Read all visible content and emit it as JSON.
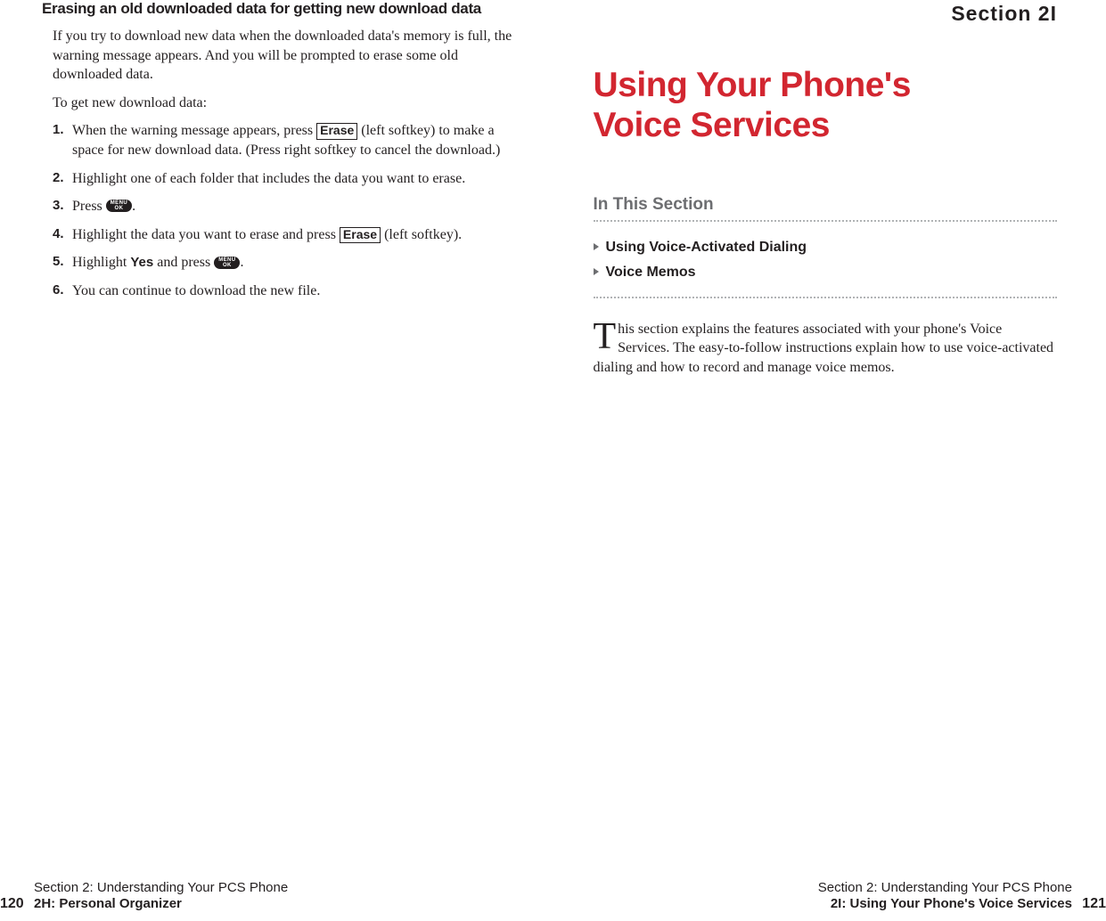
{
  "left": {
    "heading": "Erasing an old downloaded data for getting new download data",
    "intro": "If you try to download new data when the downloaded data's memory is full, the warning message appears. And you will be prompted to erase some old downloaded data.",
    "lead": "To get new download data:",
    "steps": {
      "s1a": "When the warning message appears, press ",
      "s1_key": "Erase",
      "s1b": " (left softkey) to make a space for new download data. (Press right softkey to cancel the download.)",
      "s2": "Highlight one of each folder that includes the data you want to erase.",
      "s3a": "Press ",
      "s3b": ".",
      "s4a": "Highlight the data you want to erase and press ",
      "s4_key": "Erase",
      "s4b": " (left softkey).",
      "s5a": "Highlight ",
      "s5_yes": "Yes",
      "s5b": " and press ",
      "s5c": ".",
      "s6": "You can continue to download the new file."
    },
    "menu_ok": {
      "l1": "MENU",
      "l2": "OK"
    },
    "footer": {
      "line1": "Section 2: Understanding Your PCS Phone",
      "line2": "2H: Personal Organizer",
      "page": "120"
    }
  },
  "right": {
    "section_label": "Section 2I",
    "title_line1": "Using Your Phone's",
    "title_line2": "Voice Services",
    "in_this_section": "In This Section",
    "toc": [
      "Using Voice-Activated Dialing",
      "Voice Memos"
    ],
    "dropcap": "T",
    "intro_rest": "his section explains the features associated with your phone's Voice Services. The easy-to-follow instructions explain how to use voice-activated dialing and how to record and manage voice memos.",
    "footer": {
      "line1": "Section 2: Understanding Your PCS Phone",
      "line2": "2I: Using Your Phone's Voice Services",
      "page": "121"
    }
  }
}
